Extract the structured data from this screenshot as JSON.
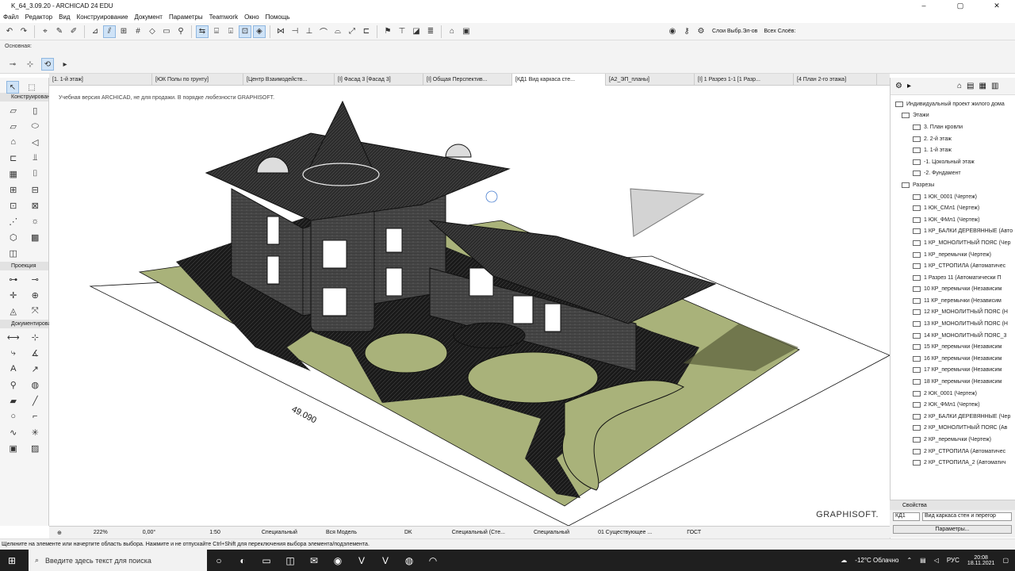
{
  "window": {
    "title": "K_64_3.09.20 - ARCHICAD 24 EDU",
    "minimize": "–",
    "maximize": "▢",
    "close": "✕"
  },
  "menu": [
    "Файл",
    "Редактор",
    "Вид",
    "Конструирование",
    "Документ",
    "Параметры",
    "Teamwork",
    "Окно",
    "Помощь"
  ],
  "toolbar": {
    "layers_label": "Слои Выбр.Эл-ов",
    "all_layers_label": "Всех Слоёв:"
  },
  "infobox": {
    "label": "Основная:"
  },
  "tabs": [
    "[1. 1-й этаж]",
    "[ЮК Полы по грунту]",
    "[Центр Взаимодейств...",
    "[I] Фасад 3 [Фасад 3]",
    "[I] Общая Перспектив...",
    "[КД1 Вид каркаса сте...",
    "[А2_ЭП_планы]",
    "[I] 1 Разрез 1-1 [1 Разр...",
    "[4 План 2-го этажа]"
  ],
  "toolbox": {
    "group1": "Конструирование",
    "group2": "Проекция",
    "group3": "Документирование"
  },
  "canvas": {
    "watermark": "Учебная версия ARCHICAD, не для продажи. В порядке любезности GRAPHISOFT.",
    "dimension": "49.090",
    "brand": "GRAPHISOFT."
  },
  "navigator": {
    "items": [
      "Индивидуальный проект жилого дома",
      "Этажи",
      "3. План кровли",
      "2. 2-й этаж",
      "1. 1-й этаж",
      "-1. Цокольный этаж",
      "-2. Фундамент",
      "Разрезы",
      "1 ЮК_0001 (Чертеж)",
      "1 ЮК_СМл1 (Чертеж)",
      "1 ЮК_ФМл1 (Чертеж)",
      "1 КР_БАЛКИ ДЕРЕВЯННЫЕ (Авто",
      "1 КР_МОНОЛИТНЫЙ ПОЯС (Чер",
      "1 КР_перемычки (Чертеж)",
      "1 КР_СТРОПИЛА (Автоматичес",
      "1 Разрез 11 (Автоматически П",
      "10 КР_перемычки (Независим",
      "11 КР_перемычки (Независим",
      "12 КР_МОНОЛИТНЫЙ ПОЯС (Н",
      "13 КР_МОНОЛИТНЫЙ ПОЯС (Н",
      "14 КР_МОНОЛИТНЫЙ ПОЯС_3",
      "15 КР_перемычки (Независим",
      "16 КР_перемычки (Независим",
      "17 КР_перемычки (Независим",
      "18 КР_перемычки (Независим",
      "2 ЮК_0001 (Чертеж)",
      "2 ЮК_ФМл1 (Чертеж)",
      "2 КР_БАЛКИ ДЕРЕВЯННЫЕ (Чер",
      "2 КР_МОНОЛИТНЫЙ ПОЯС (Ав",
      "2 КР_перемычки (Чертеж)",
      "2 КР_СТРОПИЛА (Автоматичес",
      "2 КР_СТРОПИЛА_2 (Автоматич"
    ]
  },
  "properties": {
    "title": "Свойства",
    "id": "КД1",
    "name": "Вид каркаса стен и перегор",
    "button": "Параметры..."
  },
  "statusbar": [
    "222%",
    "0,00°",
    "1:50",
    "Специальный",
    "Вся Модель",
    "DK",
    "Специальный (Сте...",
    "Специальный",
    "01 Существующее ...",
    "ГОСТ"
  ],
  "hint": "Щелкните на элементе или начертите область выбора. Нажмите и не отпускайте Ctrl+Shift для переключения выбора элемента/подэлемента.",
  "taskbar": {
    "search": "Введите здесь текст для поиска",
    "weather": "-12°С Облачно",
    "lang": "РУС",
    "time": "20:08",
    "date": "18.11.2021"
  },
  "colors": {
    "grass": "#a9b27a",
    "roof": "#2a2a2a",
    "selection": "#cfe3f7"
  }
}
